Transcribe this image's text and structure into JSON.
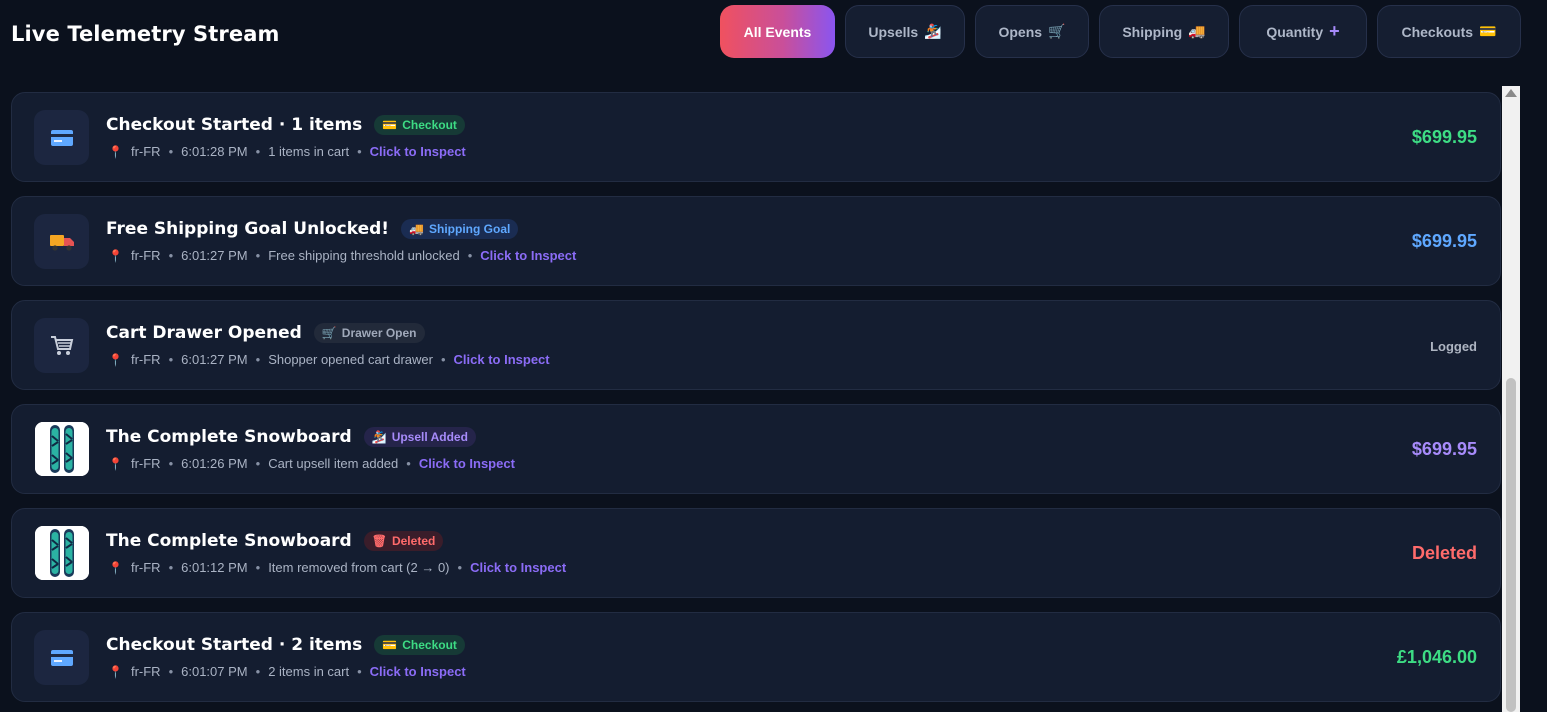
{
  "header": {
    "title": "Live Telemetry Stream"
  },
  "filters": [
    {
      "label": "All Events",
      "icon": "",
      "active": true
    },
    {
      "label": "Upsells",
      "icon": "🏂"
    },
    {
      "label": "Opens",
      "icon": "🛒"
    },
    {
      "label": "Shipping",
      "icon": "🚚"
    },
    {
      "label": "Quantity",
      "icon": "➕"
    },
    {
      "label": "Checkouts",
      "icon": "💳"
    }
  ],
  "events": [
    {
      "title": "Checkout Started · 1 items",
      "tag_icon": "💳",
      "tag": "Checkout",
      "locale": "fr-FR",
      "time": "6:01:28 PM",
      "detail": "1 items in cart",
      "inspect": "Click to Inspect",
      "value": "$699.95",
      "icon": "💳"
    },
    {
      "title": "Free Shipping Goal Unlocked!",
      "tag_icon": "🚚",
      "tag": "Shipping Goal",
      "locale": "fr-FR",
      "time": "6:01:27 PM",
      "detail": "Free shipping threshold unlocked",
      "inspect": "Click to Inspect",
      "value": "$699.95",
      "icon": "🚚"
    },
    {
      "title": "Cart Drawer Opened",
      "tag_icon": "🛒",
      "tag": "Drawer Open",
      "locale": "fr-FR",
      "time": "6:01:27 PM",
      "detail": "Shopper opened cart drawer",
      "inspect": "Click to Inspect",
      "value": "Logged",
      "icon": "🛒"
    },
    {
      "title": "The Complete Snowboard",
      "tag_icon": "🏂",
      "tag": "Upsell Added",
      "locale": "fr-FR",
      "time": "6:01:26 PM",
      "detail": "Cart upsell item added",
      "inspect": "Click to Inspect",
      "value": "$699.95",
      "icon": "snowboard-image"
    },
    {
      "title": "The Complete Snowboard",
      "tag_icon": "🗑",
      "tag": "Deleted",
      "locale": "fr-FR",
      "time": "6:01:12 PM",
      "detail": "Item removed from cart (2 → 0)",
      "inspect": "Click to Inspect",
      "value": "Deleted",
      "icon": "snowboard-image"
    },
    {
      "title": "Checkout Started · 2 items",
      "tag_icon": "💳",
      "tag": "Checkout",
      "locale": "fr-FR",
      "time": "6:01:07 PM",
      "detail": "2 items in cart",
      "inspect": "Click to Inspect",
      "value": "£1,046.00",
      "icon": "💳"
    }
  ],
  "colors": {
    "background": "#0b111d",
    "card": "#141d30",
    "accent_gradient": [
      "#f0515f",
      "#8a55f0"
    ],
    "green": "#3ddc84",
    "blue": "#5fa8ff",
    "purple": "#a78bfa",
    "red": "#ff6b6b",
    "inspect_link": "#8b6cf6"
  }
}
